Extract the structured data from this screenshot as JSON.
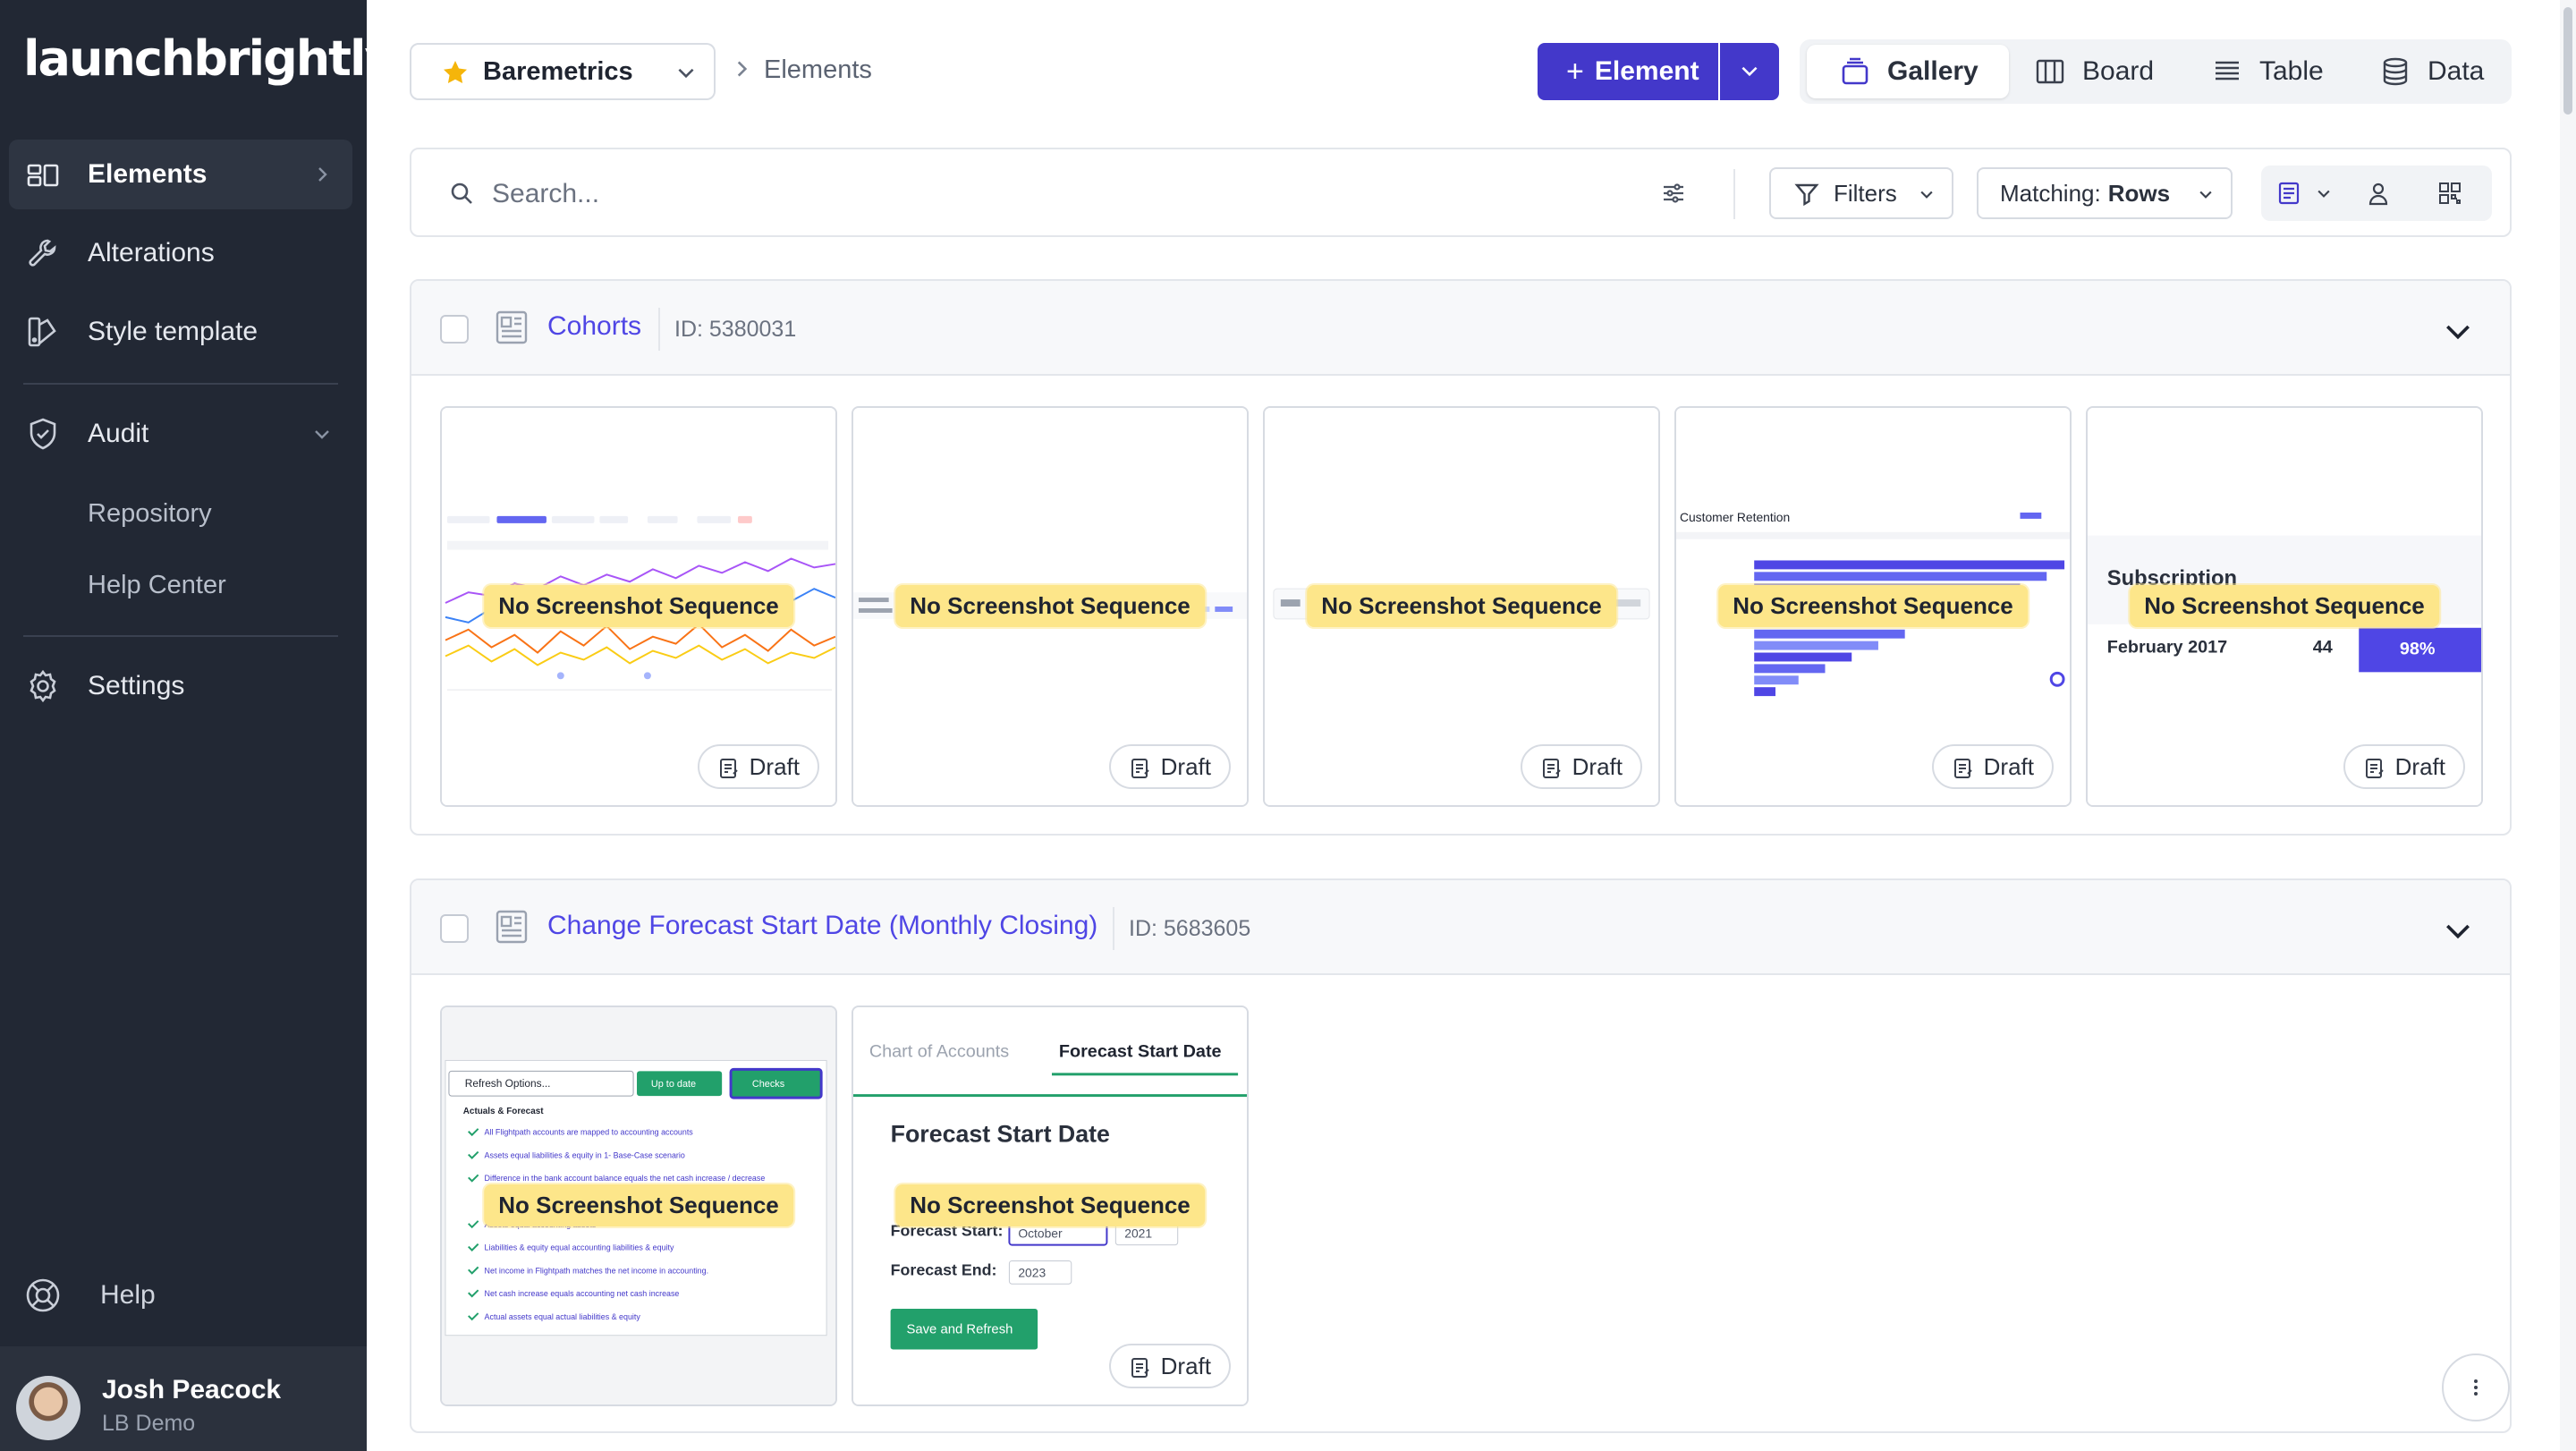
{
  "brand": {
    "logo_text": "launchbrightly"
  },
  "sidebar": {
    "items": [
      {
        "label": "Elements"
      },
      {
        "label": "Alterations"
      },
      {
        "label": "Style template"
      },
      {
        "label": "Audit"
      }
    ],
    "audit_children": [
      {
        "label": "Repository"
      },
      {
        "label": "Help Center"
      }
    ],
    "settings_label": "Settings",
    "help_label": "Help"
  },
  "user": {
    "name": "Josh Peacock",
    "org": "LB Demo"
  },
  "topbar": {
    "workspace": "Baremetrics",
    "breadcrumb": "Elements",
    "add_button": "Element",
    "views": [
      {
        "label": "Gallery"
      },
      {
        "label": "Board"
      },
      {
        "label": "Table"
      },
      {
        "label": "Data"
      }
    ]
  },
  "search": {
    "placeholder": "Search...",
    "filters_label": "Filters",
    "matching_prefix": "Matching:",
    "matching_value": "Rows"
  },
  "groups": [
    {
      "title": "Cohorts",
      "id_text": "ID: 5380031",
      "cards": [
        {
          "badge": "No Screenshot Sequence",
          "status": "Draft"
        },
        {
          "badge": "No Screenshot Sequence",
          "status": "Draft"
        },
        {
          "badge": "No Screenshot Sequence",
          "status": "Draft"
        },
        {
          "badge": "No Screenshot Sequence",
          "status": "Draft"
        },
        {
          "badge": "No Screenshot Sequence",
          "status": "Draft"
        }
      ]
    },
    {
      "title": "Change Forecast Start Date (Monthly Closing)",
      "id_text": "ID: 5683605",
      "cards": [
        {
          "badge": "No Screenshot Sequence",
          "status": "Draft"
        },
        {
          "badge": "No Screenshot Sequence",
          "status": "Draft"
        }
      ]
    }
  ],
  "thumbnails": {
    "card_retention": {
      "title": "Customer Retention"
    },
    "card_subscription": {
      "title": "Subscription",
      "month": "February 2017",
      "count": "44",
      "pct": "98%"
    },
    "card_refresh": {
      "dropdown": "Refresh Options...",
      "uptodate": "Up to date",
      "checks": "Checks",
      "section": "Actuals & Forecast",
      "lines": [
        "All Flightpath accounts are mapped to accounting accounts",
        "Assets equal liabilities & equity in 1- Base-Case scenario",
        "Difference in the bank account balance equals the net cash increase / decrease",
        "Assets equal accounting assets",
        "Liabilities & equity equal accounting liabilities & equity",
        "Net income in Flightpath matches the net income in accounting.",
        "Net cash increase equals accounting net cash increase",
        "Actual assets equal actual liabilities & equity"
      ]
    },
    "card_forecast": {
      "tab1": "Chart of Accounts",
      "tab2": "Forecast Start Date",
      "heading": "Forecast Start Date",
      "start_label": "Forecast Start:",
      "start_month": "October",
      "start_year": "2021",
      "end_label": "Forecast End:",
      "end_year": "2023",
      "save_button": "Save and Refresh"
    }
  },
  "colors": {
    "accent": "#4338ca",
    "sidebar": "#222834",
    "badge": "#fde68a",
    "link": "#4f46e5"
  }
}
